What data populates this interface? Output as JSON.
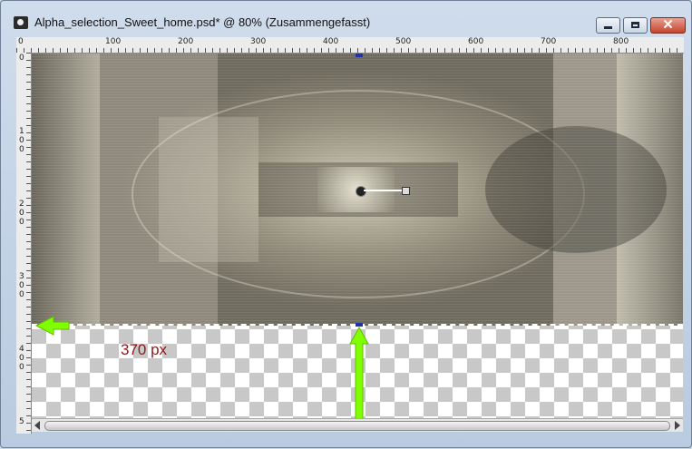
{
  "window": {
    "title": "Alpha_selection_Sweet_home.psd* @  80% (Zusammengefasst)",
    "close_glyph": "✕",
    "minimize_icon": "minimize-icon",
    "maximize_icon": "maximize-icon",
    "app_icon": "paint-app-icon"
  },
  "rulers": {
    "top_labels": [
      "0",
      "100",
      "200",
      "300",
      "400",
      "500",
      "600",
      "700",
      "800"
    ],
    "left_labels": [
      "0",
      "1\n0\n0",
      "2\n0\n0",
      "3\n0\n0",
      "4\n0\n0",
      "5"
    ]
  },
  "annotation": {
    "text": "370 px"
  },
  "colors": {
    "accent_arrow": "#7fff00",
    "annotation_text": "#8b1a1a"
  }
}
